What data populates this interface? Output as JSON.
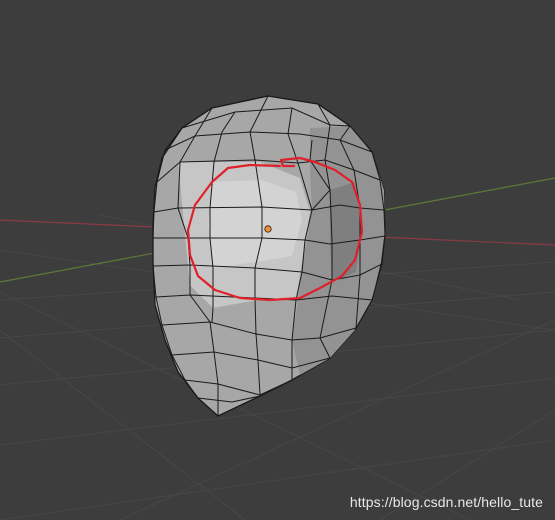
{
  "viewport": {
    "background_color": "#3d3d3d",
    "grid_color": "#474747",
    "x_axis_color": "#8a3a46",
    "y_axis_color": "#5d7a3a",
    "mesh_face_color": "#a9a9a9",
    "mesh_highlight_color": "#d0d0d0",
    "mesh_edge_color": "#1a1a1a",
    "annotation_color": "#e0202a",
    "origin_color": "#f0903a"
  },
  "watermark": {
    "text": "https://blog.csdn.net/hello_tute"
  }
}
